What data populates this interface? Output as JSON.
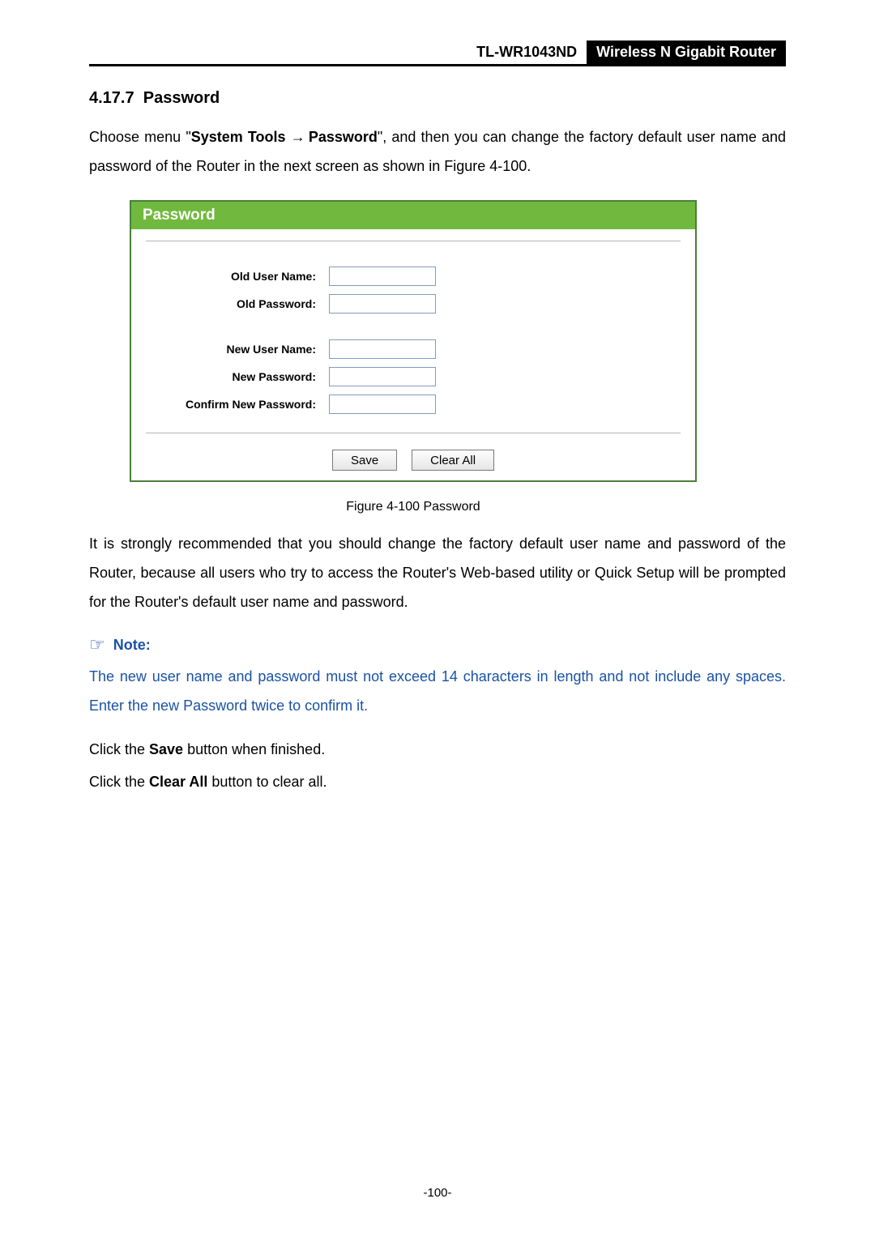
{
  "header": {
    "model": "TL-WR1043ND",
    "product": "Wireless N Gigabit Router"
  },
  "section": {
    "number": "4.17.7",
    "title": "Password"
  },
  "intro": {
    "prefix": "Choose menu \"",
    "menu1": "System Tools",
    "menu2": "Password",
    "suffix": "\", and then you can change the factory default user name and password of the Router in the next screen as shown in Figure 4-100."
  },
  "figure": {
    "title": "Password",
    "labels": {
      "old_user": "Old User Name:",
      "old_pass": "Old Password:",
      "new_user": "New User Name:",
      "new_pass": "New Password:",
      "confirm": "Confirm New Password:"
    },
    "buttons": {
      "save": "Save",
      "clear": "Clear All"
    },
    "caption": "Figure 4-100    Password"
  },
  "recommend_text": "It is strongly recommended that you should change the factory default user name and password of the Router, because all users who try to access the Router's Web-based utility or Quick Setup will be prompted for the Router's default user name and password.",
  "note": {
    "label": "Note:",
    "text": "The new user name and password must not exceed 14 characters in length and not include any spaces. Enter the new Password twice to confirm it."
  },
  "save_line": {
    "pre": "Click the ",
    "bold": "Save",
    "post": " button when finished."
  },
  "clear_line": {
    "pre": "Click the ",
    "bold": "Clear All",
    "post": " button to clear all."
  },
  "page_number": "-100-"
}
